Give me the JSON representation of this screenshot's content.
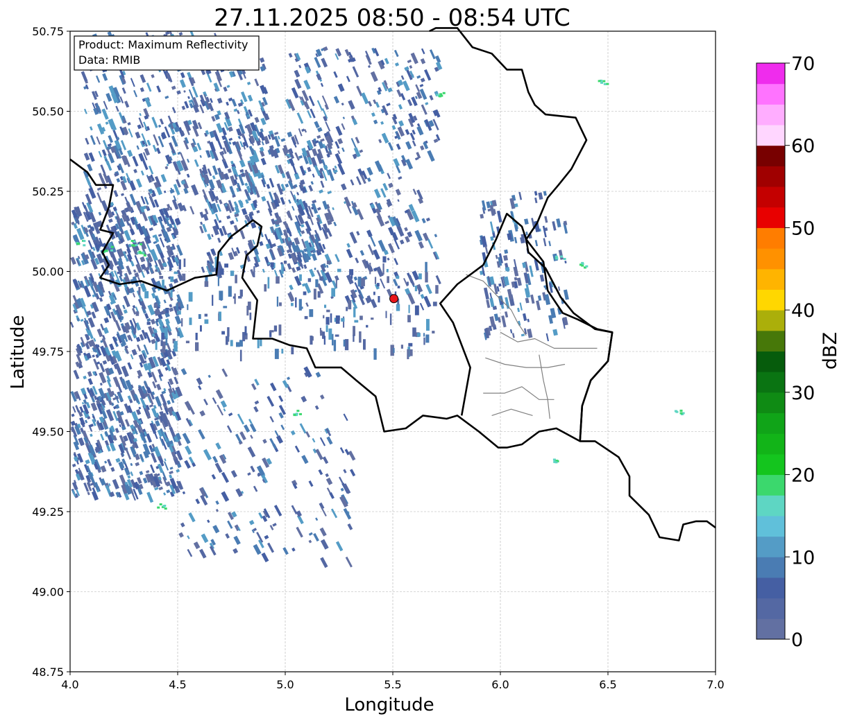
{
  "title": "27.11.2025 08:50 - 08:54 UTC",
  "info_box": {
    "product_line": "Product: Maximum Reflectivity",
    "data_line": "Data: RMIB"
  },
  "map": {
    "xlabel": "Longitude",
    "ylabel": "Latitude",
    "xlim": [
      4.0,
      7.0
    ],
    "ylim": [
      48.75,
      50.75
    ],
    "grid": true,
    "x_ticks": [
      "4.0",
      "4.5",
      "5.0",
      "5.5",
      "6.0",
      "6.5",
      "7.0"
    ],
    "y_ticks": [
      "48.75",
      "49.00",
      "49.25",
      "49.50",
      "49.75",
      "50.00",
      "50.25",
      "50.50",
      "50.75"
    ],
    "radar_site": {
      "lon": 5.505,
      "lat": 49.915,
      "color": "#e8161b"
    },
    "borders": {
      "country_line_color": "#000000",
      "province_line_color": "#808080",
      "belgium_france_border": [
        [
          4.0,
          50.35
        ],
        [
          4.08,
          50.31
        ],
        [
          4.12,
          50.27
        ],
        [
          4.2,
          50.27
        ],
        [
          4.18,
          50.2
        ],
        [
          4.14,
          50.13
        ],
        [
          4.2,
          50.12
        ],
        [
          4.15,
          50.06
        ],
        [
          4.18,
          50.02
        ],
        [
          4.14,
          49.98
        ],
        [
          4.23,
          49.96
        ],
        [
          4.33,
          49.97
        ],
        [
          4.45,
          49.94
        ],
        [
          4.58,
          49.98
        ],
        [
          4.68,
          49.99
        ],
        [
          4.69,
          50.06
        ],
        [
          4.75,
          50.11
        ],
        [
          4.85,
          50.16
        ],
        [
          4.89,
          50.14
        ],
        [
          4.87,
          50.08
        ],
        [
          4.82,
          50.05
        ],
        [
          4.8,
          49.98
        ],
        [
          4.87,
          49.91
        ],
        [
          4.85,
          49.79
        ],
        [
          4.94,
          49.79
        ],
        [
          5.02,
          49.77
        ],
        [
          5.1,
          49.76
        ],
        [
          5.14,
          49.7
        ],
        [
          5.26,
          49.7
        ],
        [
          5.33,
          49.66
        ],
        [
          5.42,
          49.61
        ],
        [
          5.46,
          49.5
        ],
        [
          5.56,
          49.51
        ],
        [
          5.64,
          49.55
        ],
        [
          5.75,
          49.54
        ],
        [
          5.8,
          49.55
        ],
        [
          5.9,
          49.5
        ],
        [
          5.99,
          49.45
        ],
        [
          6.03,
          49.45
        ],
        [
          6.1,
          49.46
        ],
        [
          6.18,
          49.5
        ],
        [
          6.26,
          49.51
        ],
        [
          6.37,
          49.47
        ],
        [
          6.44,
          49.47
        ],
        [
          6.55,
          49.42
        ],
        [
          6.6,
          49.36
        ],
        [
          6.6,
          49.3
        ],
        [
          6.69,
          49.24
        ],
        [
          6.74,
          49.17
        ],
        [
          6.83,
          49.16
        ],
        [
          6.85,
          49.21
        ],
        [
          6.91,
          49.22
        ],
        [
          6.96,
          49.22
        ],
        [
          7.0,
          49.2
        ]
      ],
      "france_ardennes_south": [
        [
          4.8,
          49.98
        ],
        [
          4.87,
          49.91
        ],
        [
          4.85,
          49.79
        ]
      ],
      "luxembourg_outline": [
        [
          5.82,
          49.55
        ],
        [
          5.86,
          49.7
        ],
        [
          5.78,
          49.84
        ],
        [
          5.72,
          49.9
        ],
        [
          5.8,
          49.96
        ],
        [
          5.92,
          50.02
        ],
        [
          5.98,
          50.1
        ],
        [
          6.03,
          50.18
        ],
        [
          6.1,
          50.14
        ],
        [
          6.12,
          50.1
        ],
        [
          6.2,
          50.03
        ],
        [
          6.22,
          49.94
        ],
        [
          6.29,
          49.87
        ],
        [
          6.36,
          49.85
        ],
        [
          6.45,
          49.82
        ],
        [
          6.52,
          49.81
        ],
        [
          6.5,
          49.72
        ],
        [
          6.42,
          49.66
        ],
        [
          6.38,
          49.58
        ],
        [
          6.37,
          49.47
        ]
      ],
      "belgium_germany_border": [
        [
          5.67,
          50.75
        ],
        [
          5.7,
          50.76
        ],
        [
          5.8,
          50.76
        ],
        [
          5.87,
          50.7
        ],
        [
          5.96,
          50.68
        ],
        [
          6.03,
          50.63
        ],
        [
          6.1,
          50.63
        ],
        [
          6.13,
          50.56
        ],
        [
          6.16,
          50.52
        ],
        [
          6.21,
          50.49
        ],
        [
          6.35,
          50.48
        ],
        [
          6.4,
          50.41
        ],
        [
          6.33,
          50.32
        ],
        [
          6.27,
          50.27
        ],
        [
          6.22,
          50.23
        ],
        [
          6.17,
          50.15
        ],
        [
          6.15,
          50.13
        ],
        [
          6.12,
          50.1
        ]
      ],
      "lux_germany_border": [
        [
          6.12,
          50.1
        ],
        [
          6.13,
          50.06
        ],
        [
          6.21,
          50.01
        ],
        [
          6.28,
          49.92
        ],
        [
          6.34,
          49.87
        ],
        [
          6.44,
          49.82
        ],
        [
          6.52,
          49.81
        ],
        [
          6.5,
          49.72
        ],
        [
          6.42,
          49.66
        ],
        [
          6.38,
          49.58
        ],
        [
          6.37,
          49.47
        ]
      ],
      "province_lines": [
        [
          [
            5.84,
            49.99
          ],
          [
            5.92,
            49.97
          ],
          [
            5.99,
            49.92
          ],
          [
            6.05,
            49.88
          ]
        ],
        [
          [
            6.0,
            49.81
          ],
          [
            6.08,
            49.78
          ],
          [
            6.16,
            49.79
          ],
          [
            6.25,
            49.76
          ],
          [
            6.35,
            49.76
          ],
          [
            6.45,
            49.76
          ]
        ],
        [
          [
            5.93,
            49.73
          ],
          [
            6.02,
            49.71
          ],
          [
            6.12,
            49.7
          ],
          [
            6.22,
            49.7
          ],
          [
            6.3,
            49.71
          ]
        ],
        [
          [
            5.92,
            49.62
          ],
          [
            6.02,
            49.62
          ],
          [
            6.1,
            49.64
          ],
          [
            6.18,
            49.6
          ],
          [
            6.25,
            49.6
          ]
        ],
        [
          [
            6.05,
            49.88
          ],
          [
            6.08,
            49.84
          ],
          [
            6.12,
            49.8
          ]
        ],
        [
          [
            6.18,
            49.74
          ],
          [
            6.2,
            49.66
          ],
          [
            6.22,
            49.6
          ],
          [
            6.23,
            49.54
          ]
        ],
        [
          [
            5.96,
            49.55
          ],
          [
            6.05,
            49.57
          ],
          [
            6.15,
            49.55
          ]
        ]
      ]
    }
  },
  "colorbar": {
    "label": "dBZ",
    "min": 0,
    "max": 70,
    "ticks": [
      "0",
      "10",
      "20",
      "30",
      "40",
      "50",
      "60",
      "70"
    ],
    "bins": [
      "#6270a2",
      "#5468a3",
      "#455fa3",
      "#4a7cb3",
      "#549cc6",
      "#60c0da",
      "#5ed6c3",
      "#3bd86d",
      "#14c51e",
      "#12b418",
      "#10a418",
      "#0f8b14",
      "#0a7412",
      "#065c0c",
      "#477809",
      "#abaf0a",
      "#ffd700",
      "#ffb400",
      "#ff9100",
      "#ff7d00",
      "#e80000",
      "#c40000",
      "#a00000",
      "#780000",
      "#ffd6ff",
      "#ffadff",
      "#ff73ff",
      "#ef2ced"
    ]
  }
}
